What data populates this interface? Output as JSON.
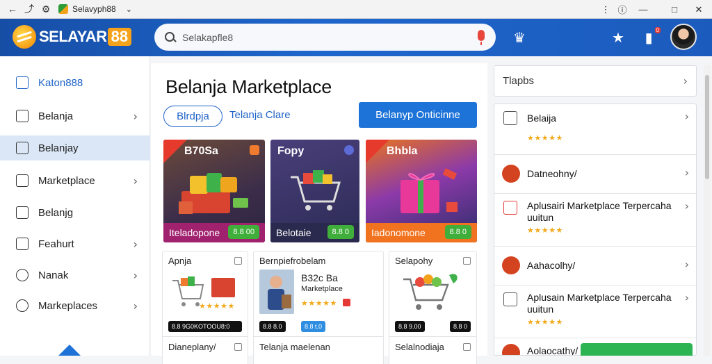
{
  "browser": {
    "tab_title": "Selavyph88",
    "back_icon": "arrow-left-icon",
    "win_buttons": [
      "minimize",
      "maximize",
      "close"
    ]
  },
  "header": {
    "logo_word": "SELAYAR",
    "logo_num": "88",
    "search_placeholder": "Selakapfle8",
    "notif_badge": "0"
  },
  "sidebar": {
    "items": [
      {
        "label": "Katon888",
        "chevron": false
      },
      {
        "label": "Belanja",
        "chevron": true
      },
      {
        "label": "Belanjay",
        "chevron": false
      },
      {
        "label": "Marketplace",
        "chevron": true
      },
      {
        "label": "Belanjg",
        "chevron": false
      },
      {
        "label": "Feahurt",
        "chevron": true
      },
      {
        "label": "Nanak",
        "chevron": true
      },
      {
        "label": "Markeplaces",
        "chevron": true
      }
    ]
  },
  "main": {
    "title": "Belanja Marketplace",
    "pill": "Blrdpja",
    "link": "Telanja Clare",
    "cta": "Belanyp Onticinne",
    "cards": [
      {
        "title": "B70Sa",
        "foot": "Iteladopone",
        "price": "8.8 00"
      },
      {
        "title": "Fopy",
        "foot": "Belotaie",
        "price": "8.8 0"
      },
      {
        "title": "Bhbla",
        "foot": "Iadonomone",
        "price": "8.8 0"
      }
    ],
    "products": [
      {
        "title": "Apnja",
        "tag": "8.8 9G0KOTOOU8:0",
        "stars": "★★★★★"
      },
      {
        "title": "Bernpiefrobelam",
        "name": "B32c Ba",
        "sub": "Marketplace",
        "tag1": "8.8 8.0",
        "tag2": "8.8 t.0",
        "stars": "★★★★★"
      },
      {
        "title": "Selapohy",
        "tag1": "8.8 9.00",
        "tag2": "8.8 0",
        "stars": ""
      }
    ],
    "rows": [
      "Dianeplany/",
      "Telanja maelenan",
      "Selalnodiaja"
    ]
  },
  "right": {
    "search_label": "Tlapbs",
    "items": [
      {
        "text": "Belaija",
        "stars": "★★★★★"
      },
      {
        "text": "Datneohny/",
        "stars": ""
      },
      {
        "text": "Aplusairi Marketplace Terpercaha uuitun",
        "stars": "★★★★★"
      },
      {
        "text": "Aahacolhy/",
        "stars": ""
      },
      {
        "text": "Aplusain Marketplace Terpercaha uuitun",
        "stars": "★★★★★"
      },
      {
        "text": "Aolaocathy/",
        "stars": ""
      }
    ]
  },
  "colors": {
    "header_blue": "#1f66cc",
    "accent_orange": "#f7a21b",
    "link_blue": "#1e63c7",
    "cta_blue": "#1e73d8",
    "price_green": "#3fae3a",
    "star_gold": "#f2a91b"
  }
}
